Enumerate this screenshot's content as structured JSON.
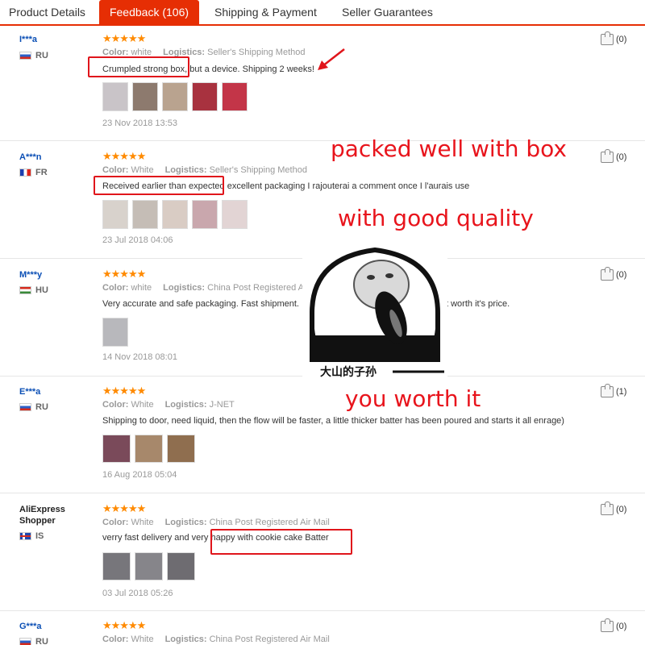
{
  "tabs": [
    {
      "label": "Product Details"
    },
    {
      "label": "Feedback (106)"
    },
    {
      "label": "Shipping & Payment"
    },
    {
      "label": "Seller Guarantees"
    }
  ],
  "labels": {
    "color": "Color:",
    "logistics": "Logistics:"
  },
  "reviews": [
    {
      "user": "I***a",
      "country": "RU",
      "stars": "★★★★★",
      "color": "white",
      "logistics": "Seller's Shipping Method",
      "text": "Crumpled strong box, but a device. Shipping 2 weeks!",
      "date": "23 Nov 2018 13:53",
      "helpful": "(0)"
    },
    {
      "user": "A***n",
      "country": "FR",
      "stars": "★★★★★",
      "color": "White",
      "logistics": "Seller's Shipping Method",
      "text": "Received earlier than expected excellent packaging I rajouterai a comment once I l'aurais use",
      "date": "23 Jul 2018 04:06",
      "helpful": "(0)"
    },
    {
      "user": "M***y",
      "country": "HU",
      "stars": "★★★★★",
      "color": "white",
      "logistics": "China Post Registered Air",
      "text": "Very accurate and safe packaging. Fast shipment.",
      "text2": "t worth it's price.",
      "date": "14 Nov 2018 08:01",
      "helpful": "(0)"
    },
    {
      "user": "E***a",
      "country": "RU",
      "stars": "★★★★★",
      "color": "White",
      "logistics": "J-NET",
      "text": "Shipping to door, need liquid, then the flow will be faster, a little thicker batter has been poured and starts it all enrage)",
      "date": "16 Aug 2018 05:04",
      "helpful": "(1)"
    },
    {
      "user": "AliExpress Shopper",
      "country": "IS",
      "stars": "★★★★★",
      "color": "White",
      "logistics": "China Post Registered Air Mail",
      "text": "verry fast delivery and very happy with cookie cake Batter",
      "date": "03 Jul 2018 05:26",
      "helpful": "(0)"
    },
    {
      "user": "G***a",
      "country": "RU",
      "stars": "★★★★★",
      "color": "White",
      "logistics": "China Post Registered Air Mail",
      "helpful": "(0)"
    }
  ],
  "overlays": {
    "packed": "packed well with box",
    "quality": "with good quality",
    "worth": "you worth it",
    "meme_caption": "大山的子孙"
  },
  "colors": {
    "accent": "#e62e04",
    "highlight": "#e0151b",
    "star": "#ff8a00",
    "username": "#0b4fb5"
  }
}
